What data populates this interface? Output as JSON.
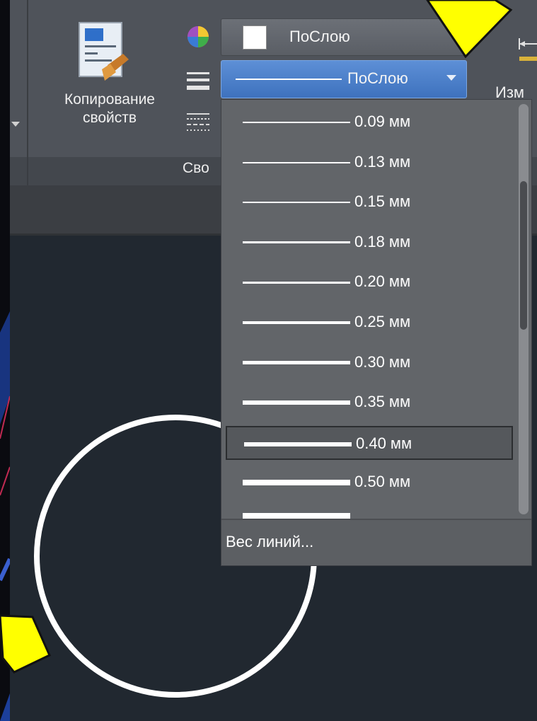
{
  "ribbon": {
    "copy_properties_label_1": "Копирование",
    "copy_properties_label_2": "свойств",
    "group_label": "Сво",
    "right_cut_label": "Изм"
  },
  "color_combo": {
    "value": "ПоСлою",
    "swatch_color": "#ffffff"
  },
  "lineweight_combo": {
    "value": "ПоСлою"
  },
  "lineweight_list": {
    "items": [
      {
        "label": "0.09 мм",
        "weight": 0.09
      },
      {
        "label": "0.13 мм",
        "weight": 0.13
      },
      {
        "label": "0.15 мм",
        "weight": 0.15
      },
      {
        "label": "0.18 мм",
        "weight": 0.18
      },
      {
        "label": "0.20 мм",
        "weight": 0.2
      },
      {
        "label": "0.25 мм",
        "weight": 0.25
      },
      {
        "label": "0.30 мм",
        "weight": 0.3
      },
      {
        "label": "0.35 мм",
        "weight": 0.35
      },
      {
        "label": "0.40 мм",
        "weight": 0.4,
        "selected": true
      },
      {
        "label": "0.50 мм",
        "weight": 0.5
      }
    ],
    "footer_label": "Вес линий..."
  },
  "colors": {
    "accent_highlight": "#4a80cc",
    "arrow_yellow": "#ffff00",
    "canvas": "#212830"
  }
}
